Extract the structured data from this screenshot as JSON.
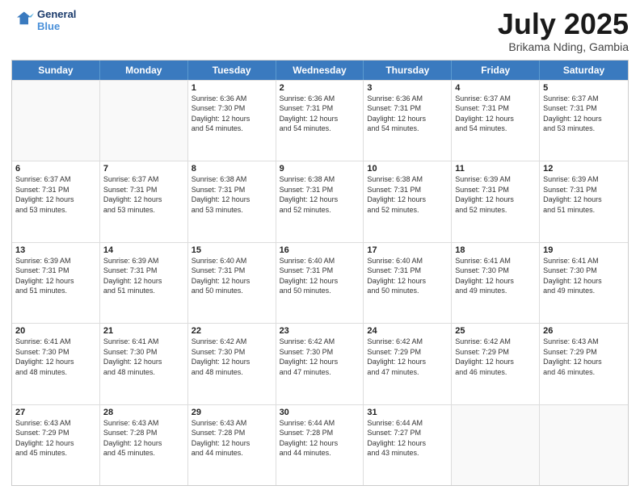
{
  "header": {
    "logo_line1": "General",
    "logo_line2": "Blue",
    "month_title": "July 2025",
    "location": "Brikama Nding, Gambia"
  },
  "day_headers": [
    "Sunday",
    "Monday",
    "Tuesday",
    "Wednesday",
    "Thursday",
    "Friday",
    "Saturday"
  ],
  "weeks": [
    [
      {
        "day": "",
        "info": ""
      },
      {
        "day": "",
        "info": ""
      },
      {
        "day": "1",
        "info": "Sunrise: 6:36 AM\nSunset: 7:30 PM\nDaylight: 12 hours\nand 54 minutes."
      },
      {
        "day": "2",
        "info": "Sunrise: 6:36 AM\nSunset: 7:31 PM\nDaylight: 12 hours\nand 54 minutes."
      },
      {
        "day": "3",
        "info": "Sunrise: 6:36 AM\nSunset: 7:31 PM\nDaylight: 12 hours\nand 54 minutes."
      },
      {
        "day": "4",
        "info": "Sunrise: 6:37 AM\nSunset: 7:31 PM\nDaylight: 12 hours\nand 54 minutes."
      },
      {
        "day": "5",
        "info": "Sunrise: 6:37 AM\nSunset: 7:31 PM\nDaylight: 12 hours\nand 53 minutes."
      }
    ],
    [
      {
        "day": "6",
        "info": "Sunrise: 6:37 AM\nSunset: 7:31 PM\nDaylight: 12 hours\nand 53 minutes."
      },
      {
        "day": "7",
        "info": "Sunrise: 6:37 AM\nSunset: 7:31 PM\nDaylight: 12 hours\nand 53 minutes."
      },
      {
        "day": "8",
        "info": "Sunrise: 6:38 AM\nSunset: 7:31 PM\nDaylight: 12 hours\nand 53 minutes."
      },
      {
        "day": "9",
        "info": "Sunrise: 6:38 AM\nSunset: 7:31 PM\nDaylight: 12 hours\nand 52 minutes."
      },
      {
        "day": "10",
        "info": "Sunrise: 6:38 AM\nSunset: 7:31 PM\nDaylight: 12 hours\nand 52 minutes."
      },
      {
        "day": "11",
        "info": "Sunrise: 6:39 AM\nSunset: 7:31 PM\nDaylight: 12 hours\nand 52 minutes."
      },
      {
        "day": "12",
        "info": "Sunrise: 6:39 AM\nSunset: 7:31 PM\nDaylight: 12 hours\nand 51 minutes."
      }
    ],
    [
      {
        "day": "13",
        "info": "Sunrise: 6:39 AM\nSunset: 7:31 PM\nDaylight: 12 hours\nand 51 minutes."
      },
      {
        "day": "14",
        "info": "Sunrise: 6:39 AM\nSunset: 7:31 PM\nDaylight: 12 hours\nand 51 minutes."
      },
      {
        "day": "15",
        "info": "Sunrise: 6:40 AM\nSunset: 7:31 PM\nDaylight: 12 hours\nand 50 minutes."
      },
      {
        "day": "16",
        "info": "Sunrise: 6:40 AM\nSunset: 7:31 PM\nDaylight: 12 hours\nand 50 minutes."
      },
      {
        "day": "17",
        "info": "Sunrise: 6:40 AM\nSunset: 7:31 PM\nDaylight: 12 hours\nand 50 minutes."
      },
      {
        "day": "18",
        "info": "Sunrise: 6:41 AM\nSunset: 7:30 PM\nDaylight: 12 hours\nand 49 minutes."
      },
      {
        "day": "19",
        "info": "Sunrise: 6:41 AM\nSunset: 7:30 PM\nDaylight: 12 hours\nand 49 minutes."
      }
    ],
    [
      {
        "day": "20",
        "info": "Sunrise: 6:41 AM\nSunset: 7:30 PM\nDaylight: 12 hours\nand 48 minutes."
      },
      {
        "day": "21",
        "info": "Sunrise: 6:41 AM\nSunset: 7:30 PM\nDaylight: 12 hours\nand 48 minutes."
      },
      {
        "day": "22",
        "info": "Sunrise: 6:42 AM\nSunset: 7:30 PM\nDaylight: 12 hours\nand 48 minutes."
      },
      {
        "day": "23",
        "info": "Sunrise: 6:42 AM\nSunset: 7:30 PM\nDaylight: 12 hours\nand 47 minutes."
      },
      {
        "day": "24",
        "info": "Sunrise: 6:42 AM\nSunset: 7:29 PM\nDaylight: 12 hours\nand 47 minutes."
      },
      {
        "day": "25",
        "info": "Sunrise: 6:42 AM\nSunset: 7:29 PM\nDaylight: 12 hours\nand 46 minutes."
      },
      {
        "day": "26",
        "info": "Sunrise: 6:43 AM\nSunset: 7:29 PM\nDaylight: 12 hours\nand 46 minutes."
      }
    ],
    [
      {
        "day": "27",
        "info": "Sunrise: 6:43 AM\nSunset: 7:29 PM\nDaylight: 12 hours\nand 45 minutes."
      },
      {
        "day": "28",
        "info": "Sunrise: 6:43 AM\nSunset: 7:28 PM\nDaylight: 12 hours\nand 45 minutes."
      },
      {
        "day": "29",
        "info": "Sunrise: 6:43 AM\nSunset: 7:28 PM\nDaylight: 12 hours\nand 44 minutes."
      },
      {
        "day": "30",
        "info": "Sunrise: 6:44 AM\nSunset: 7:28 PM\nDaylight: 12 hours\nand 44 minutes."
      },
      {
        "day": "31",
        "info": "Sunrise: 6:44 AM\nSunset: 7:27 PM\nDaylight: 12 hours\nand 43 minutes."
      },
      {
        "day": "",
        "info": ""
      },
      {
        "day": "",
        "info": ""
      }
    ]
  ]
}
